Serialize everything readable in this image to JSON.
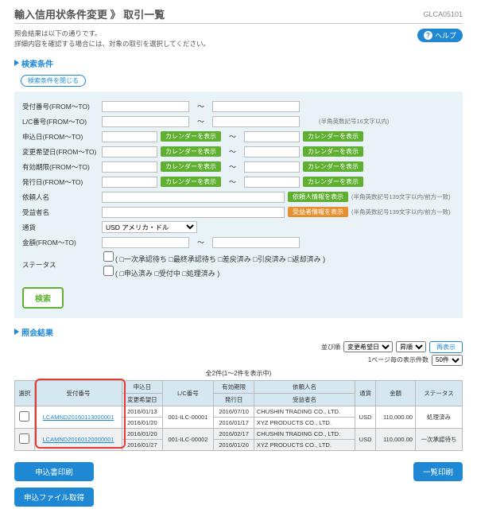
{
  "screen_id": "GLCA05101",
  "title": "輸入信用状条件変更  》 取引一覧",
  "msg1": "照会結果は以下の通りです。",
  "msg2": "詳細内容を確認する場合には、対象の取引を選択してください。",
  "help": "ヘルプ",
  "sec1": "検索条件",
  "close_search": "検索条件を閉じる",
  "lbl": {
    "a": "受付番号(FROM～TO)",
    "b": "L/C番号(FROM～TO)",
    "c": "申込日(FROM～TO)",
    "d": "変更希望日(FROM～TO)",
    "e": "有効期限(FROM～TO)",
    "f": "発行日(FROM～TO)",
    "g": "依頼人名",
    "h": "受益者名",
    "i": "通貨",
    "j": "金額(FROM～TO)",
    "k": "ステータス"
  },
  "btn": {
    "cal": "カレンダーを表示",
    "reqinfo": "依頼人情報を表示",
    "beninfo": "受益者情報を表示",
    "search": "検索",
    "redisp": "再表示",
    "p1": "申込書印刷",
    "p2": "申込ファイル取得",
    "p3": "一覧印刷"
  },
  "hint": {
    "lc": "(半角英数記号16文字以内)",
    "name": "(半角英数記号139文字以内/前方一致)"
  },
  "currency": "USD  アメリカ・ドル",
  "st": {
    "s1": "( □一次承認待ち □最終承認待ち □差戻済み □引戻済み □返却済み  )",
    "s2": "( □申込済み □受付中 □処理済み  )"
  },
  "sec2": "照会結果",
  "sort": {
    "l1": "並び順",
    "v1": "変更希望日",
    "v2": "昇順",
    "l2": "1ページ毎の表示件数",
    "v3": "50件"
  },
  "pager": "全2件(1～2件を表示中)",
  "th": {
    "sel": "選択",
    "rn": "受付番号",
    "ad": "申込日",
    "cd": "変更希望日",
    "lc": "L/C番号",
    "exp": "有効期限",
    "id": "発行日",
    "ap": "依頼人名",
    "bn": "受益者名",
    "cur": "通貨",
    "amt": "金額",
    "st": "ステータス"
  },
  "rows": [
    {
      "rn": "LCAMND20160113000001",
      "ad": "2016/01/13",
      "cd": "2016/01/20",
      "lc": "001-ILC-00001",
      "exp": "2016/07/10",
      "id": "2016/01/17",
      "ap": "CHUSHIN TRADING CO., LTD.",
      "bn": "XYZ PRODUCTS CO., LTD.",
      "cur": "USD",
      "amt": "110,000.00",
      "st": "処理済み"
    },
    {
      "rn": "LCAMND20160120000001",
      "ad": "2016/01/20",
      "cd": "2016/01/27",
      "lc": "001-ILC-00002",
      "exp": "2016/02/17",
      "id": "2016/01/20",
      "ap": "CHUSHIN TRADING CO., LTD.",
      "bn": "XYZ PRODUCTS CO., LTD.",
      "cur": "USD",
      "amt": "110,000.00",
      "st": "一次承認待ち"
    }
  ]
}
